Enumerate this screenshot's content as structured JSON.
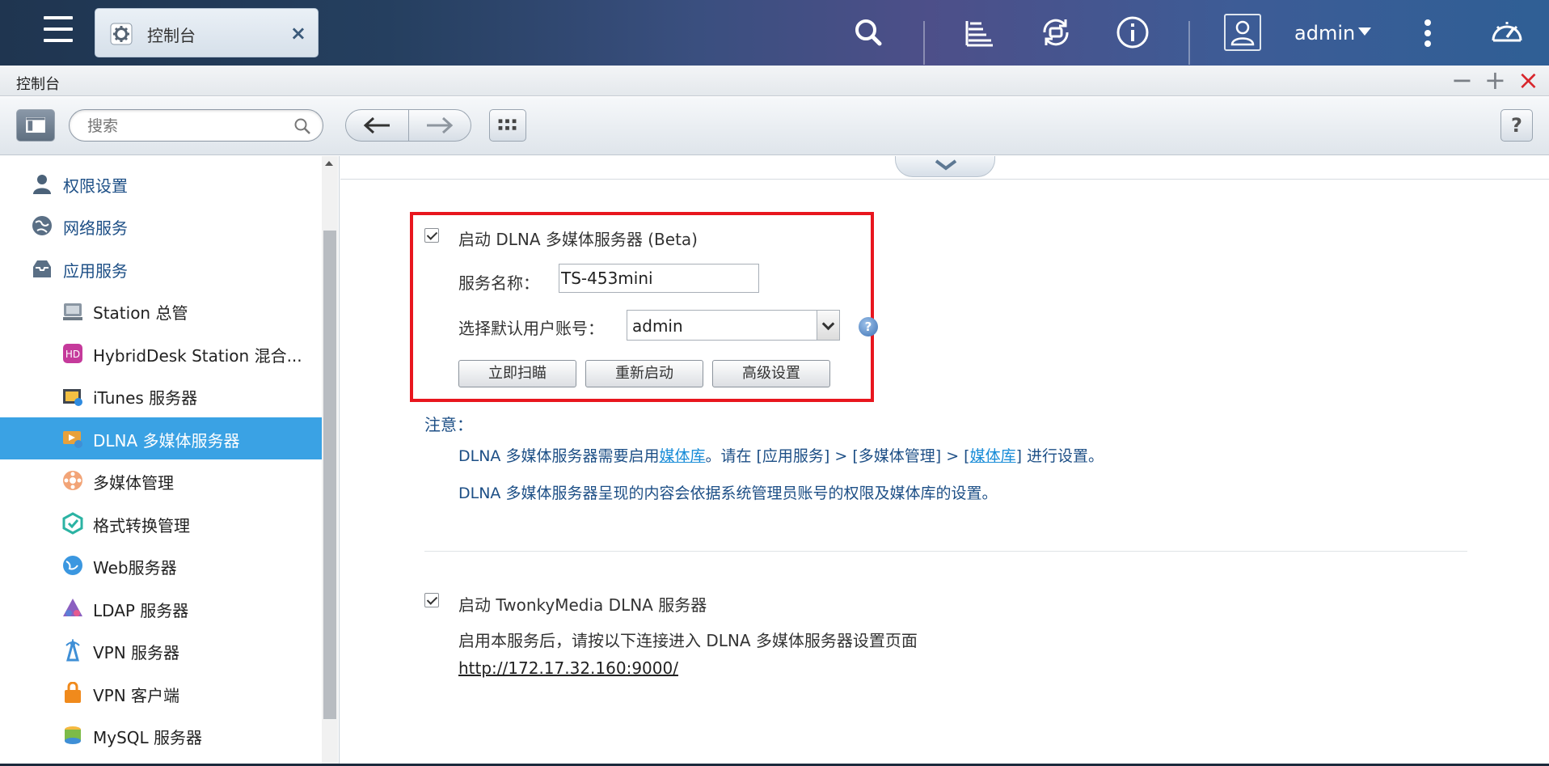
{
  "taskbar": {
    "tab_label": "控制台",
    "tab_close": "×",
    "user_name": "admin"
  },
  "window": {
    "title": "控制台",
    "minimize": "−",
    "maximize": "+",
    "close": "×"
  },
  "toolbar": {
    "search_placeholder": "搜索",
    "help_label": "?"
  },
  "sidebar": {
    "items": [
      {
        "label": "权限设置",
        "level": "top",
        "icon": "user-icon"
      },
      {
        "label": "网络服务",
        "level": "top",
        "icon": "globe-icon"
      },
      {
        "label": "应用服务",
        "level": "top",
        "icon": "inbox-icon"
      },
      {
        "label": "Station 总管",
        "level": "sub",
        "icon": "station-icon"
      },
      {
        "label": "HybridDesk Station 混合...",
        "level": "sub",
        "icon": "hybriddesk-icon"
      },
      {
        "label": "iTunes 服务器",
        "level": "sub",
        "icon": "itunes-icon"
      },
      {
        "label": "DLNA 多媒体服务器",
        "level": "sub",
        "icon": "dlna-icon",
        "active": true
      },
      {
        "label": "多媒体管理",
        "level": "sub",
        "icon": "media-icon"
      },
      {
        "label": "格式转换管理",
        "level": "sub",
        "icon": "transcode-icon"
      },
      {
        "label": "Web服务器",
        "level": "sub",
        "icon": "web-icon"
      },
      {
        "label": "LDAP 服务器",
        "level": "sub",
        "icon": "ldap-icon"
      },
      {
        "label": "VPN 服务器",
        "level": "sub",
        "icon": "vpn-server-icon"
      },
      {
        "label": "VPN 客户端",
        "level": "sub",
        "icon": "vpn-client-icon"
      },
      {
        "label": "MySQL 服务器",
        "level": "sub",
        "icon": "mysql-icon"
      }
    ]
  },
  "dlna": {
    "enable_label": "启动 DLNA 多媒体服务器 (Beta)",
    "enabled": true,
    "service_name_label": "服务名称：",
    "service_name_value": "TS-453mini",
    "default_user_label": "选择默认用户账号：",
    "default_user_value": "admin",
    "help": "?",
    "buttons": {
      "scan": "立即扫瞄",
      "restart": "重新启动",
      "advanced": "高级设置"
    }
  },
  "notes": {
    "title": "注意：",
    "line1_a": "DLNA 多媒体服务器需要启用",
    "line1_link1": "媒体库",
    "line1_b": "。请在 [应用服务] > [多媒体管理] > [",
    "line1_link2": "媒体库",
    "line1_c": "] 进行设置。",
    "line2": "DLNA 多媒体服务器呈现的内容会依据系统管理员账号的权限及媒体库的设置。"
  },
  "twonky": {
    "enable_label": "启动 TwonkyMedia DLNA 服务器",
    "enabled": true,
    "desc": "启用本服务后，请按以下连接进入 DLNA 多媒体服务器设置页面",
    "url": "http://172.17.32.160:9000/"
  },
  "colors": {
    "accent_active": "#3aa2e4",
    "highlight_border": "#e8161e",
    "note_text": "#1d4f86",
    "link": "#1a8dd8"
  }
}
